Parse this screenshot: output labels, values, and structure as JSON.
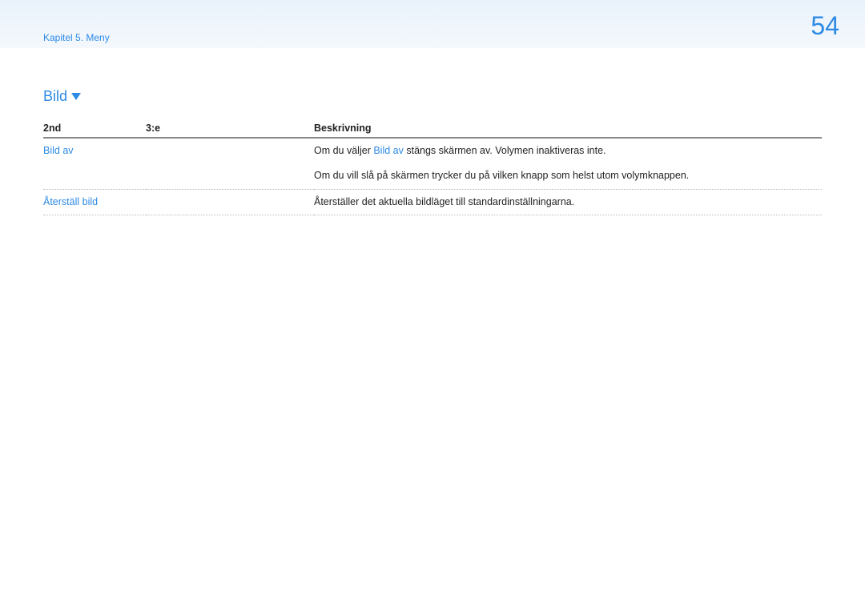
{
  "header": {
    "breadcrumb": "Kapitel 5. Meny",
    "page_number": "54"
  },
  "section": {
    "title": "Bild"
  },
  "table": {
    "headers": {
      "col1": "2nd",
      "col2": "3:e",
      "col3": "Beskrivning"
    },
    "rows": [
      {
        "col1": "Bild av",
        "col2": "",
        "desc_pre": "Om du väljer ",
        "desc_link": "Bild av",
        "desc_post": " stängs skärmen av. Volymen inaktiveras inte."
      },
      {
        "col1": "",
        "col2": "",
        "desc_plain": "Om du vill slå på skärmen trycker du på vilken knapp som helst utom volymknappen."
      },
      {
        "col1": "Återställ bild",
        "col2": "",
        "desc_plain": "Återställer det aktuella bildläget till standardinställningarna."
      }
    ]
  }
}
